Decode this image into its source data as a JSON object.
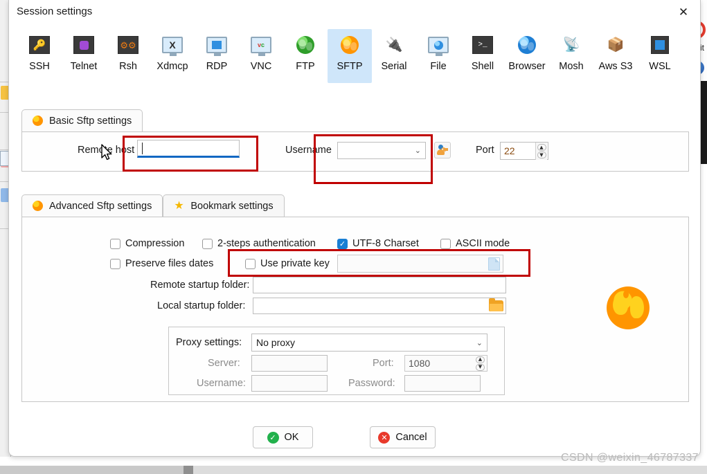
{
  "window": {
    "title": "Session settings",
    "close_label": "✕"
  },
  "protocols": [
    {
      "label": "SSH",
      "icon": "key-icon",
      "selected": false
    },
    {
      "label": "Telnet",
      "icon": "telnet-icon",
      "selected": false
    },
    {
      "label": "Rsh",
      "icon": "gears-icon",
      "selected": false
    },
    {
      "label": "Xdmcp",
      "icon": "xdmcp-icon",
      "selected": false
    },
    {
      "label": "RDP",
      "icon": "windows-icon",
      "selected": false
    },
    {
      "label": "VNC",
      "icon": "vnc-icon",
      "selected": false
    },
    {
      "label": "FTP",
      "icon": "green-globe-icon",
      "selected": false
    },
    {
      "label": "SFTP",
      "icon": "orange-globe-icon",
      "selected": true
    },
    {
      "label": "Serial",
      "icon": "plug-icon",
      "selected": false
    },
    {
      "label": "File",
      "icon": "file-monitor-icon",
      "selected": false
    },
    {
      "label": "Shell",
      "icon": "terminal-icon",
      "selected": false
    },
    {
      "label": "Browser",
      "icon": "blue-globe-icon",
      "selected": false
    },
    {
      "label": "Mosh",
      "icon": "satellite-icon",
      "selected": false
    },
    {
      "label": "Aws S3",
      "icon": "aws-s3-icon",
      "selected": false
    },
    {
      "label": "WSL",
      "icon": "wsl-icon",
      "selected": false
    }
  ],
  "basic": {
    "tab_label": "Basic Sftp settings",
    "remote_host_label": "Remote host *",
    "remote_host_value": "",
    "username_label": "Username",
    "username_value": "",
    "username_browse_icon": "user-key-icon",
    "port_label": "Port",
    "port_value": "22"
  },
  "advanced": {
    "tab_label": "Advanced Sftp settings",
    "bookmark_tab_label": "Bookmark settings",
    "checkboxes": [
      {
        "label": "Compression",
        "checked": false
      },
      {
        "label": "2-steps authentication",
        "checked": false
      },
      {
        "label": "UTF-8 Charset",
        "checked": true
      },
      {
        "label": "ASCII mode",
        "checked": false
      },
      {
        "label": "Preserve files dates",
        "checked": false
      },
      {
        "label": "Use private key",
        "checked": false
      }
    ],
    "private_key_value": "",
    "remote_startup_label": "Remote startup folder:",
    "remote_startup_value": "",
    "local_startup_label": "Local startup folder:",
    "local_startup_value": ""
  },
  "proxy": {
    "settings_label": "Proxy settings:",
    "settings_value": "No proxy",
    "server_label": "Server:",
    "server_value": "",
    "port_label": "Port:",
    "port_value": "1080",
    "username_label": "Username:",
    "username_value": "",
    "password_label": "Password:",
    "password_value": ""
  },
  "buttons": {
    "ok_label": "OK",
    "cancel_label": "Cancel"
  },
  "background": {
    "exit_text": "xit",
    "prompt_char": "t"
  },
  "watermark": "CSDN @weixin_46787337",
  "colors": {
    "accent_blue": "#1268c3",
    "selected_tile": "#cfe6fa",
    "checkbox_on": "#1a7fd4",
    "annotation_red": "#c00000",
    "ok_green": "#22b14c",
    "cancel_red": "#e8392b",
    "port_value_text": "#8a4b10"
  }
}
